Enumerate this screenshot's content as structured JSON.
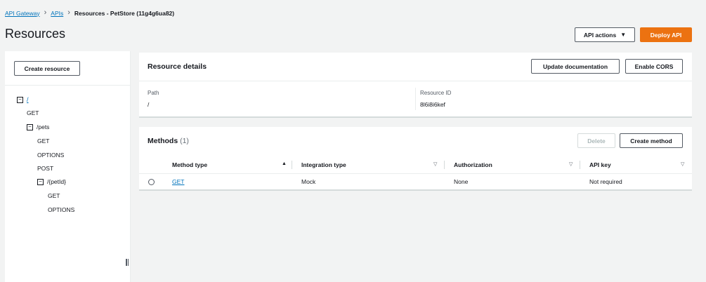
{
  "breadcrumb": {
    "items": [
      "API Gateway",
      "APIs"
    ],
    "separator": ">",
    "current": "Resources - PetStore (11g4g6ua82)"
  },
  "page": {
    "title": "Resources"
  },
  "header_actions": {
    "api_actions": "API actions",
    "deploy_api": "Deploy API"
  },
  "sidebar": {
    "create_resource": "Create resource",
    "tree": {
      "root": "/",
      "root_methods": [
        "GET"
      ],
      "pets": "/pets",
      "pets_methods": [
        "GET",
        "OPTIONS",
        "POST"
      ],
      "petid": "/{petId}",
      "petid_methods": [
        "GET",
        "OPTIONS"
      ],
      "collapse_glyph": "−"
    }
  },
  "resource_details": {
    "title": "Resource details",
    "update_documentation": "Update documentation",
    "enable_cors": "Enable CORS",
    "path_label": "Path",
    "path_value": "/",
    "resource_id_label": "Resource ID",
    "resource_id_value": "8l6i8i6kef"
  },
  "methods": {
    "title": "Methods",
    "count": "(1)",
    "delete": "Delete",
    "create_method": "Create method",
    "columns": [
      "Method type",
      "Integration type",
      "Authorization",
      "API key"
    ],
    "rows": [
      {
        "method_type": "GET",
        "integration_type": "Mock",
        "authorization": "None",
        "api_key": "Not required"
      }
    ]
  },
  "colors": {
    "accent": "#ec7211",
    "link": "#0073bb",
    "background": "#f2f3f3",
    "text": "#16191f"
  },
  "icons": {
    "breadcrumb_separator": "chevron-right-icon",
    "dropdown": "caret-down-icon",
    "sort_ascending": "sort-ascending-icon",
    "sort": "sort-icon",
    "collapse": "collapse-square-icon",
    "radio": "radio-icon",
    "drag_handle": "drag-handle-icon"
  }
}
